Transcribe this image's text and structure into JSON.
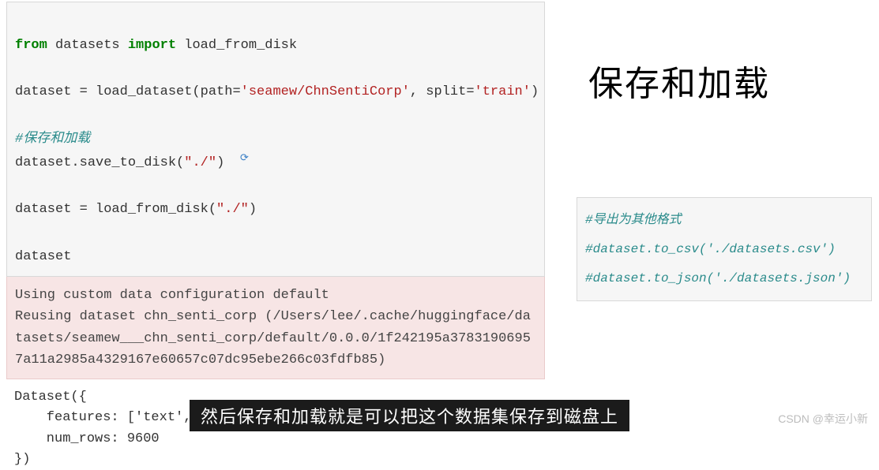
{
  "code": {
    "line1_from": "from",
    "line1_mid": " datasets ",
    "line1_import": "import",
    "line1_end": " load_from_disk",
    "line2_pre": "dataset = load_dataset(path=",
    "line2_str1": "'seamew/ChnSentiCorp'",
    "line2_mid": ", split=",
    "line2_str2": "'train'",
    "line2_end": ")",
    "line3_comment": "#保存和加载",
    "line4_pre": "dataset.save_to_disk(",
    "line4_str": "\"./\"",
    "line4_end": ")",
    "line5_pre": "dataset = load_from_disk(",
    "line5_str": "\"./\"",
    "line5_end": ")",
    "line6": "dataset"
  },
  "error": {
    "line1": "Using custom data configuration default",
    "line2": "Reusing dataset chn_senti_corp (/Users/lee/.cache/huggingface/datasets/seamew___chn_senti_corp/default/0.0.0/1f242195a37831906957a11a2985a4329167e60657c07dc95ebe266c03fdfb85)"
  },
  "output": {
    "line1": "Dataset({",
    "line2": "    features: ['text', 'label'],",
    "line3": "    num_rows: 9600",
    "line4": "})"
  },
  "right_title": "保存和加载",
  "right_code": {
    "line1": "#导出为其他格式",
    "line2": "#dataset.to_csv('./datasets.csv')",
    "line3": "#dataset.to_json('./datasets.json')"
  },
  "caption": "然后保存和加载就是可以把这个数据集保存到磁盘上",
  "watermark": "CSDN @幸运小新"
}
